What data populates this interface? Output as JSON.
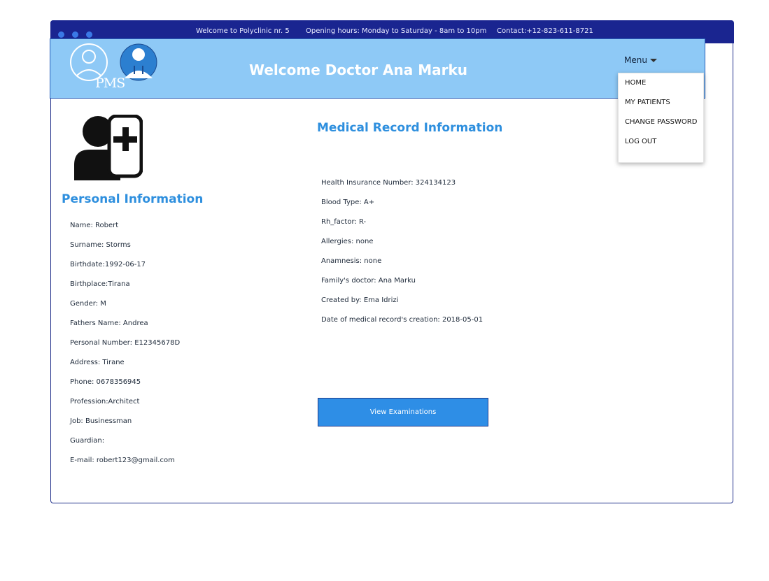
{
  "topbar": {
    "welcome": "Welcome to Polyclinic nr. 5",
    "hours": "Opening hours: Monday to Saturday - 8am to 10pm",
    "contact": "Contact:+12-823-611-8721"
  },
  "header": {
    "logo_text": "PMS",
    "welcome": "Welcome Doctor Ana Marku",
    "menu_label": "Menu"
  },
  "menu": {
    "items": [
      "HOME",
      "MY PATIENTS",
      "CHANGE PASSWORD",
      "LOG OUT"
    ]
  },
  "personal": {
    "title": "Personal Information",
    "fields": [
      "Name: Robert",
      "Surname: Storms",
      "Birthdate:1992-06-17",
      "Birthplace:Tirana",
      "Gender: M",
      "Fathers Name: Andrea",
      "Personal Number: E12345678D",
      "Address: Tirane",
      "Phone: 0678356945",
      "Profession:Architect",
      "Job: Businessman",
      "Guardian:",
      "E-mail: robert123@gmail.com"
    ]
  },
  "medical": {
    "title": "Medical Record Information",
    "fields": [
      "Health Insurance Number: 324134123",
      "Blood Type: A+",
      "Rh_factor: R-",
      "Allergies: none",
      "Anamnesis: none",
      "Family's doctor: Ana Marku",
      "Created by: Ema Idrizi",
      "Date of medical record's creation: 2018-05-01"
    ],
    "button": "View Examinations"
  },
  "colors": {
    "topbar": "#1a2590",
    "header": "#8ec9f6",
    "accent": "#2e8ee6",
    "title": "#2e8fde"
  },
  "icons": [
    "doctor-avatar-icon",
    "user-medical-icon"
  ]
}
